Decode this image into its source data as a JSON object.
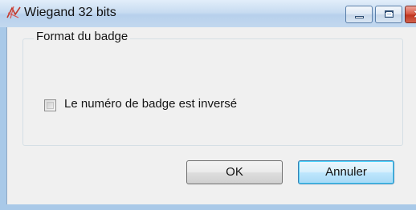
{
  "window": {
    "title": "Wiegand 32 bits",
    "icon": "wiegand-app-icon"
  },
  "caption_buttons": {
    "minimize_icon": "minimize-icon",
    "maximize_icon": "maximize-icon",
    "close_glyph": "✕"
  },
  "group": {
    "legend": "Format du badge",
    "checkbox": {
      "label": "Le numéro de badge est inversé",
      "checked": false
    }
  },
  "buttons": {
    "ok_label": "OK",
    "cancel_label": "Annuler"
  },
  "colors": {
    "frame": "#a9c9e8",
    "client": "#f0f0f0",
    "close_button": "#c7452f",
    "focused_button_border": "#3c7fb1"
  }
}
